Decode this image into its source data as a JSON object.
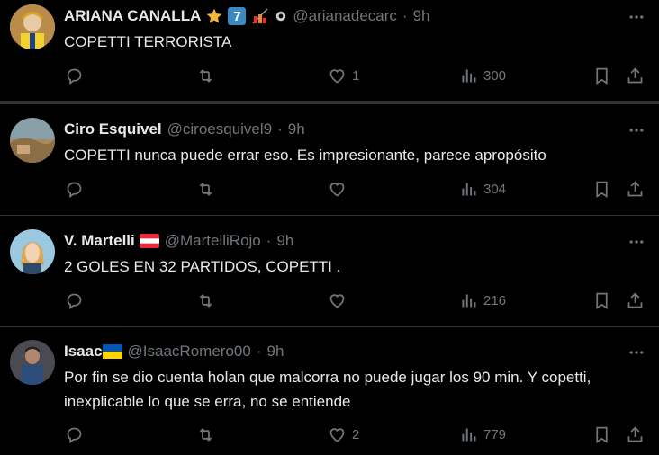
{
  "tweets": [
    {
      "name": "ARIANA CANALLA",
      "handle": "@arianadecarc",
      "time": "9h",
      "text": "COPETTI TERRORISTA",
      "badge_number": "7",
      "stats": {
        "reply": "",
        "retweet": "",
        "like": "1",
        "views": "300"
      }
    },
    {
      "name": "Ciro Esquivel",
      "handle": "@ciroesquivel9",
      "time": "9h",
      "text": "COPETTI nunca puede errar eso. Es impresionante, parece apropósito",
      "stats": {
        "reply": "",
        "retweet": "",
        "like": "",
        "views": "304"
      }
    },
    {
      "name": "V. Martelli",
      "handle": "@MartelliRojo",
      "time": "9h",
      "text": "2 GOLES EN 32 PARTIDOS, COPETTI .",
      "stats": {
        "reply": "",
        "retweet": "",
        "like": "",
        "views": "216"
      }
    },
    {
      "name": "Isaac",
      "handle": "@IsaacRomero00",
      "time": "9h",
      "text": "Por fin se dio cuenta holan que malcorra no puede jugar los 90 min. Y copetti, inexplicable lo que se erra, no se entiende",
      "stats": {
        "reply": "",
        "retweet": "",
        "like": "2",
        "views": "779"
      }
    }
  ],
  "separator": "·",
  "colors": {
    "bg": "#000000",
    "text": "#e7e9ea",
    "muted": "#71767b",
    "border": "#2f3336"
  },
  "icons": [
    "reply-icon",
    "retweet-icon",
    "like-icon",
    "views-icon",
    "bookmark-icon",
    "share-icon",
    "more-icon"
  ]
}
